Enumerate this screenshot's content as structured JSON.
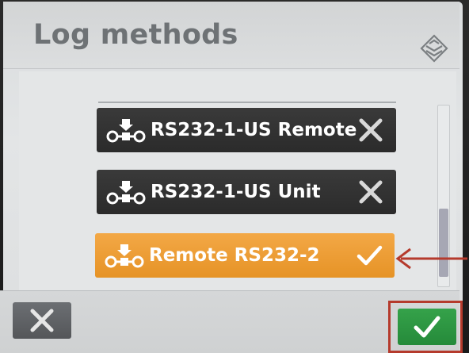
{
  "dialog": {
    "title": "Log methods",
    "header_icon": "layers-icon"
  },
  "log_methods": [
    {
      "label": "RS232-1-US Remote",
      "icon": "logging-device-icon",
      "action_icon": "remove-x-icon",
      "selected": false
    },
    {
      "label": "RS232-1-US Unit",
      "icon": "logging-device-icon",
      "action_icon": "remove-x-icon",
      "selected": false
    },
    {
      "label": "Remote RS232-2",
      "icon": "logging-device-icon",
      "action_icon": "checkmark-icon",
      "selected": true
    }
  ],
  "footer": {
    "cancel_icon": "close-x-icon",
    "confirm_icon": "checkmark-icon"
  },
  "colors": {
    "row_dark": "#2f2f2f",
    "row_selected": "#eea03c",
    "confirm_green": "#2e9844",
    "annotation_red": "#b53a2c",
    "title_gray": "#6e7275"
  }
}
